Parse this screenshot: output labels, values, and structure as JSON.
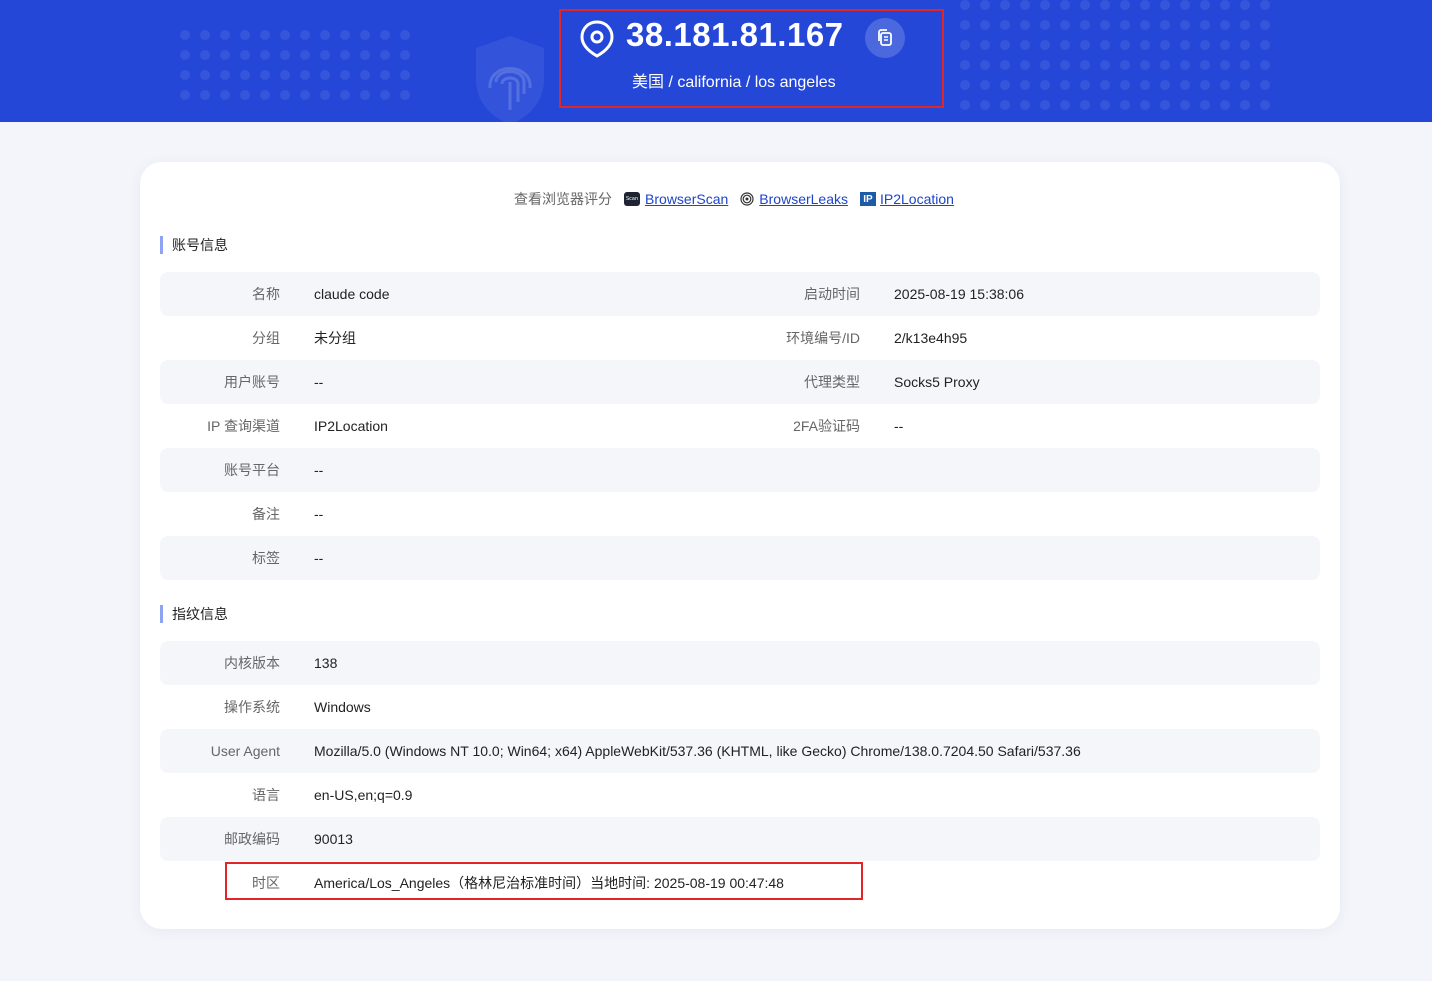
{
  "header": {
    "ip": "38.181.81.167",
    "location": "美国 / california / los angeles",
    "icons": {
      "location": "map-pin-icon",
      "copy": "copy-icon"
    },
    "background_color": "#2447d8"
  },
  "score_links": {
    "label": "查看浏览器评分",
    "links": [
      {
        "icon": "browserscan-icon",
        "icon_text": "Scan",
        "text": "BrowserScan"
      },
      {
        "icon": "fingerprint-icon",
        "text": "BrowserLeaks"
      },
      {
        "icon": "ip2location-icon",
        "icon_text": "IP",
        "text": "IP2Location"
      }
    ]
  },
  "account_info": {
    "title": "账号信息",
    "rows": [
      {
        "k1": "名称",
        "v1": "claude code",
        "k2": "启动时间",
        "v2": "2025-08-19 15:38:06"
      },
      {
        "k1": "分组",
        "v1": "未分组",
        "k2": "环境编号/ID",
        "v2": "2/k13e4h95"
      },
      {
        "k1": "用户账号",
        "v1": "--",
        "k2": "代理类型",
        "v2": "Socks5 Proxy"
      },
      {
        "k1": "IP 查询渠道",
        "v1": "IP2Location",
        "k2": "2FA验证码",
        "v2": "--"
      },
      {
        "k1": "账号平台",
        "v1": "--"
      },
      {
        "k1": "备注",
        "v1": "--"
      },
      {
        "k1": "标签",
        "v1": "--"
      }
    ]
  },
  "fingerprint_info": {
    "title": "指纹信息",
    "rows": [
      {
        "k1": "内核版本",
        "v1": "138"
      },
      {
        "k1": "操作系统",
        "v1": "Windows"
      },
      {
        "k1": "User Agent",
        "v1": "Mozilla/5.0 (Windows NT 10.0; Win64; x64) AppleWebKit/537.36 (KHTML, like Gecko) Chrome/138.0.7204.50 Safari/537.36"
      },
      {
        "k1": "语言",
        "v1": "en-US,en;q=0.9"
      },
      {
        "k1": "邮政编码",
        "v1": "90013"
      },
      {
        "k1": "时区",
        "v1": "America/Los_Angeles（格林尼治标准时间）当地时间: 2025-08-19 00:47:48"
      }
    ]
  },
  "colors": {
    "link": "#1e44c9",
    "highlight_border": "#e02626",
    "section_bar": "#8ea4f2",
    "row_stripe": "#f5f6fa"
  }
}
